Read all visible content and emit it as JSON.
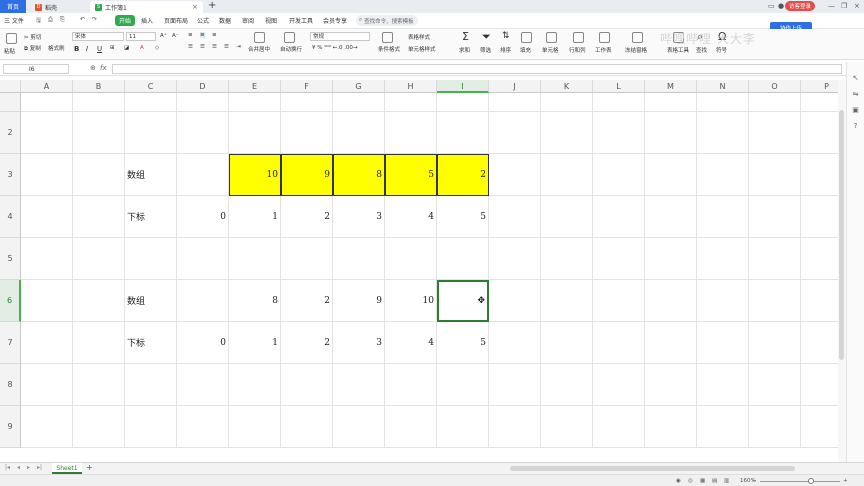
{
  "tabs": {
    "home": "首页",
    "doc": "稻壳",
    "workbook": "工作簿1",
    "doc_icon": "D",
    "workbook_icon": "S"
  },
  "titlebar": {
    "badge": "访客登录",
    "share": "协作上传"
  },
  "menu": {
    "file": "三 文件",
    "items": [
      "开始",
      "插入",
      "页面布局",
      "公式",
      "数据",
      "审阅",
      "视图",
      "开发工具",
      "会员专享"
    ],
    "search": "查找命令、搜索模板"
  },
  "ribbon": {
    "cut": "剪切",
    "copy": "复制",
    "format_painter": "格式刷",
    "paste": "粘贴",
    "font_name": "宋体",
    "font_size": "11",
    "bold": "B",
    "italic": "I",
    "underline": "U",
    "merge_center": "合并居中",
    "wrap_text": "自动换行",
    "number_format": "常规",
    "conditional": "条件格式",
    "table_style": "表格样式",
    "cell_style": "单元格样式",
    "sum": "求和",
    "filter": "筛选",
    "sort": "排序",
    "fill": "填充",
    "cell": "单元格",
    "rowcol": "行和列",
    "worksheet": "工作表",
    "freeze": "冻结窗格",
    "table_tools": "表格工具",
    "find": "查找",
    "symbol": "符号",
    "watermark": "哔哩哔哩 大大李"
  },
  "formula_bar": {
    "name_box": "I6",
    "fx": "fx",
    "zoom_icon": "⊕",
    "formula": ""
  },
  "columns": [
    "A",
    "B",
    "C",
    "D",
    "E",
    "F",
    "G",
    "H",
    "I",
    "J",
    "K",
    "L",
    "M",
    "N",
    "O",
    "P"
  ],
  "active_column": "I",
  "rows": [
    {
      "label": "2",
      "cells": {}
    },
    {
      "label": "3",
      "cells": {
        "C": "数组",
        "E": "10",
        "F": "9",
        "G": "8",
        "H": "5",
        "I": "2"
      }
    },
    {
      "label": "4",
      "cells": {
        "C": "下标",
        "D": "0",
        "E": "1",
        "F": "2",
        "G": "3",
        "H": "4",
        "I": "5"
      }
    },
    {
      "label": "5",
      "cells": {}
    },
    {
      "label": "6",
      "cells": {
        "C": "数组",
        "E": "8",
        "F": "2",
        "G": "9",
        "H": "10",
        "I": "✥"
      }
    },
    {
      "label": "7",
      "cells": {
        "C": "下标",
        "D": "0",
        "E": "1",
        "F": "2",
        "G": "3",
        "H": "4",
        "I": "5"
      }
    },
    {
      "label": "8",
      "cells": {}
    },
    {
      "label": "9",
      "cells": {}
    }
  ],
  "active_row": "6",
  "highlight": {
    "fill": "#ffff00",
    "row": "3",
    "from": "E",
    "to": "I"
  },
  "sheet": {
    "name": "Sheet1",
    "add": "+"
  },
  "status": {
    "zoom": "160%",
    "minus": "−",
    "plus": "+"
  },
  "colors": {
    "accent": "#2fa84f",
    "home_tab": "#2f6fe4",
    "selection": "#2e7d32"
  }
}
